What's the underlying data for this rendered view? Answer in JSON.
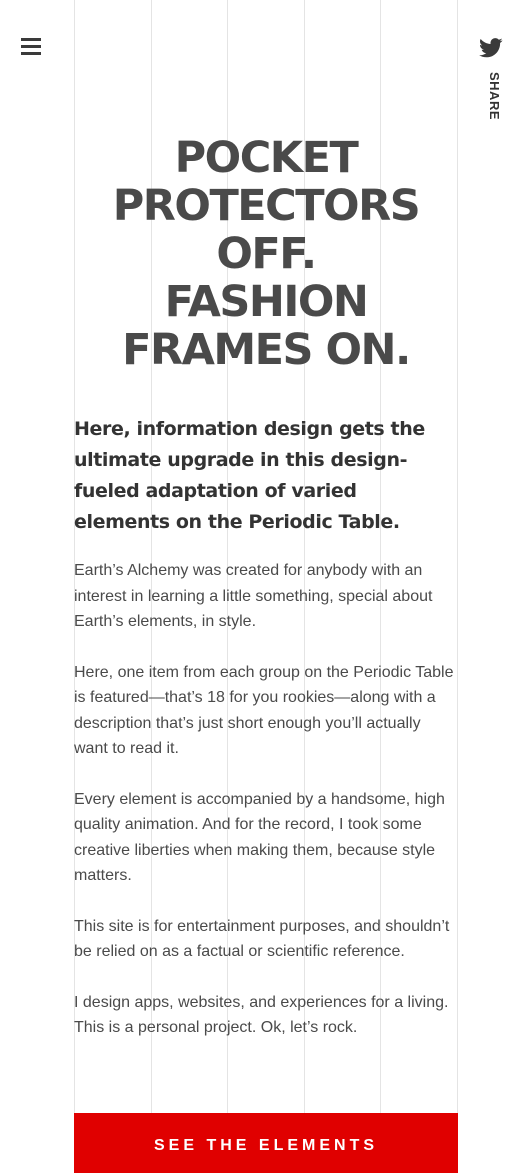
{
  "header": {
    "menu_icon": "hamburger-menu-icon",
    "share_icon": "twitter-bird-icon",
    "share_label": "SHARE"
  },
  "hero": {
    "lines": [
      "POCKET",
      "PROTECTORS",
      "OFF.",
      "FASHION",
      "FRAMES ON."
    ]
  },
  "intro": {
    "subhead": "Here, information design gets the ultimate upgrade in this design-fueled adaptation of varied elements on the Periodic Table.",
    "paragraphs": [
      "Earth’s Alchemy was created for anybody with an interest in learning a little something, special about Earth’s elements, in style.",
      "Here, one item from each group on the Periodic Table is featured—that’s 18 for you rookies—along with a description that’s just short enough you’ll actually want to read it.",
      "Every element is accompanied by a handsome, high quality animation. And for the record, I took some creative liberties when making them, because style matters.",
      "This site is for entertainment purposes, and shouldn’t be relied on as a factual or scientific reference.",
      "I design apps, websites, and experiences for a living. This is a personal project. Ok, let’s rock."
    ]
  },
  "cta": {
    "label": "SEE THE ELEMENTS"
  },
  "colors": {
    "accent": "#e00000",
    "text": "#4a4a4a",
    "grid": "#e4e4e4"
  }
}
